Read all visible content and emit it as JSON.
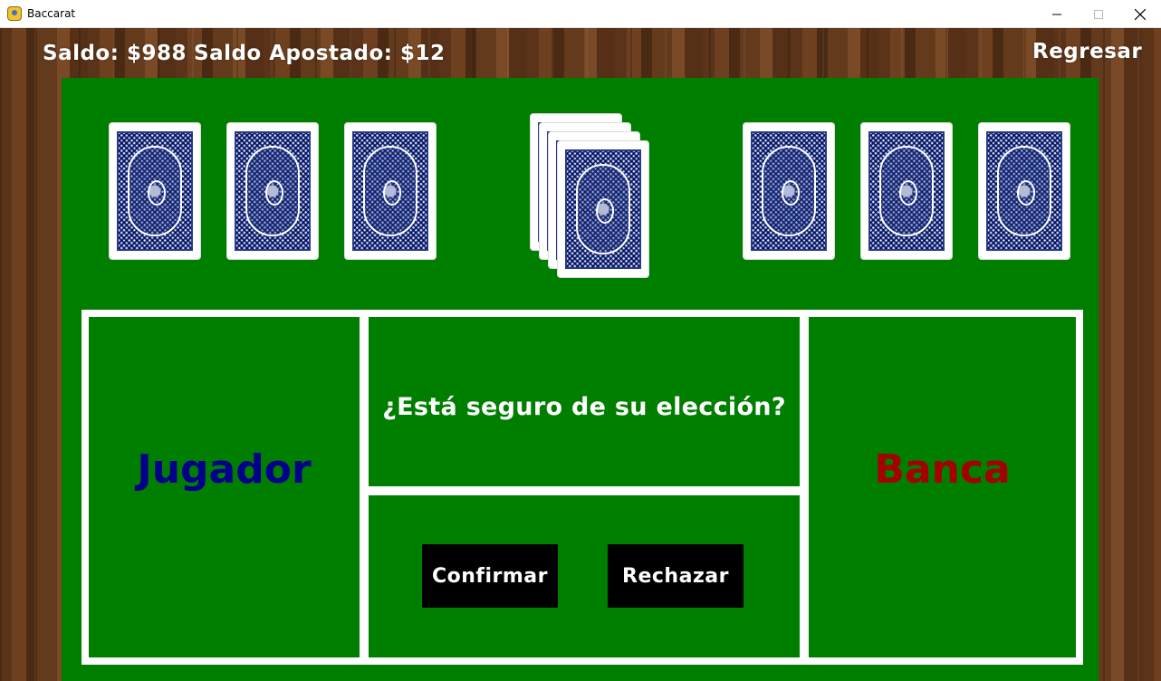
{
  "window": {
    "title": "Baccarat",
    "icon": "pygame-snake-icon"
  },
  "hud": {
    "balance": "Saldo: $988",
    "bet": "Saldo Apostado: $12",
    "back": "Regresar"
  },
  "board": {
    "player": "Jugador",
    "banker": "Banca",
    "question": "¿Está seguro de su elección?",
    "confirm": "Confirmar",
    "reject": "Rechazar"
  },
  "colors": {
    "felt": "#007e00",
    "player": "#00008b",
    "banker": "#a50000",
    "button": "#000000"
  },
  "cards": {
    "player_hand": 3,
    "banker_hand": 3,
    "deck_stack": 4
  }
}
